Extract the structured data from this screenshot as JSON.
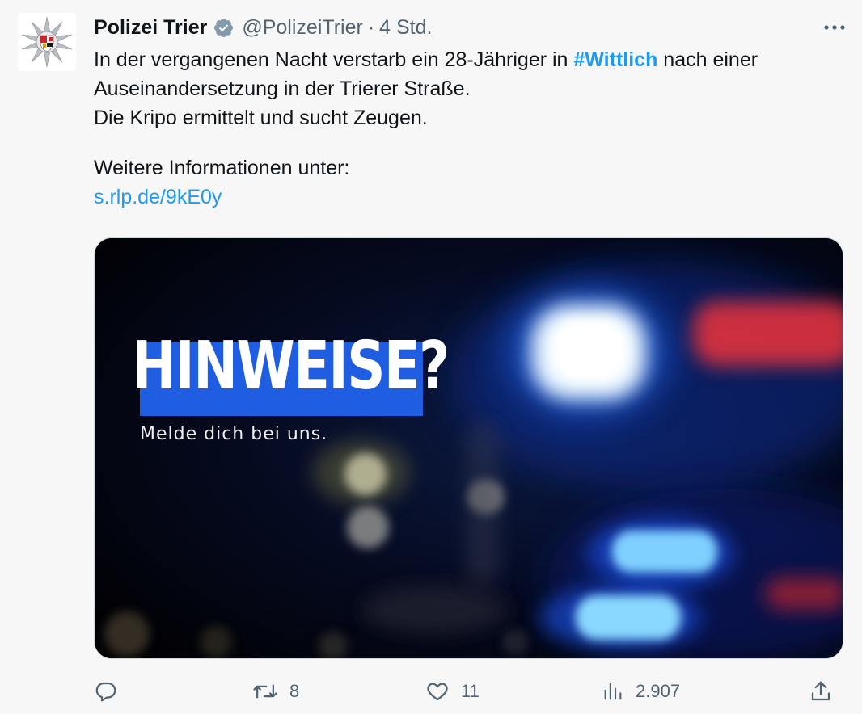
{
  "tweet": {
    "author": {
      "display_name": "Polizei Trier",
      "handle": "@PolizeiTrier",
      "verified": true,
      "avatar_icon": "police-star-crest-icon"
    },
    "separator": "·",
    "time": "4 Std.",
    "text": {
      "line1_before": "In der vergangenen Nacht verstarb ein 28-Jähriger in ",
      "hashtag": "#Wittlich",
      "line1_after": " nach einer",
      "line2": "Auseinandersetzung in der Trierer Straße.",
      "line3": "Die Kripo ermittelt und sucht Zeugen.",
      "line4": "Weitere Informationen unter:",
      "link": "s.rlp.de/9kE0y"
    },
    "media": {
      "headline": "HINWEISE?",
      "subline": "Melde dich bei uns."
    },
    "actions": {
      "reply_count": "",
      "retweet_count": "8",
      "like_count": "11",
      "views_count": "2.907"
    }
  },
  "colors": {
    "link": "#1d9bf0",
    "secondary_text": "#536471",
    "headline_highlight": "#1f5ee0"
  }
}
